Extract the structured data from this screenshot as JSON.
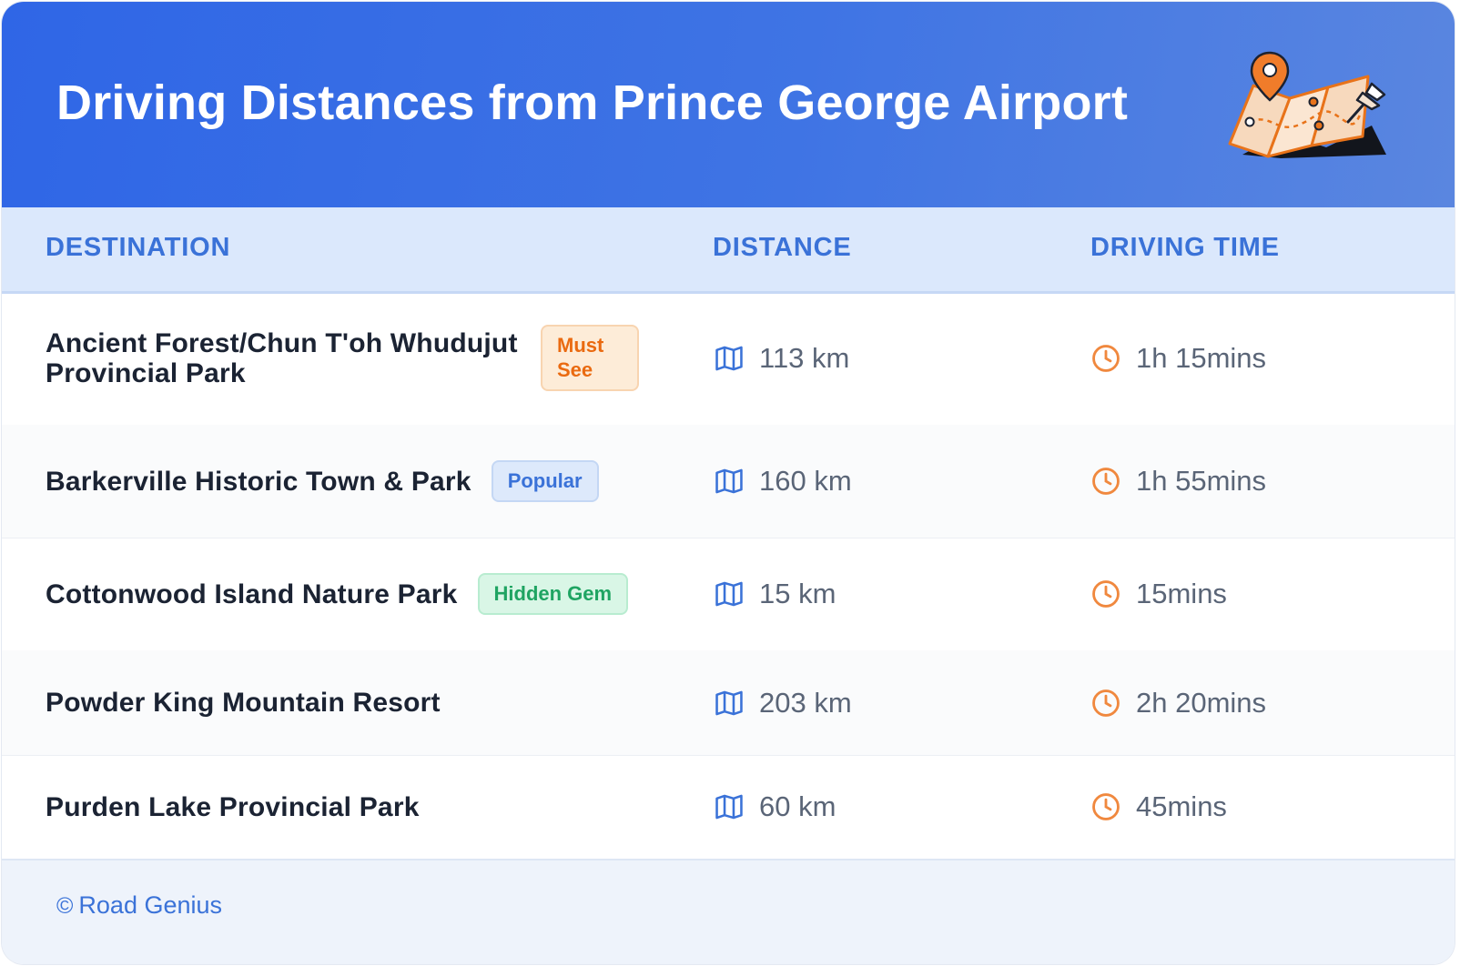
{
  "header": {
    "title": "Driving Distances from Prince George Airport",
    "illustration_icon": "folded-map-with-pins-icon"
  },
  "table": {
    "columns": [
      "DESTINATION",
      "DISTANCE",
      "DRIVING TIME"
    ],
    "rows": [
      {
        "destination": "Ancient Forest/Chun T'oh Whudujut Provincial Park",
        "badge": "Must See",
        "badge_style": "orange",
        "distance": "113 km",
        "time": "1h 15mins"
      },
      {
        "destination": "Barkerville Historic Town & Park",
        "badge": "Popular",
        "badge_style": "blue",
        "distance": "160 km",
        "time": "1h 55mins"
      },
      {
        "destination": "Cottonwood Island Nature Park",
        "badge": "Hidden Gem",
        "badge_style": "green",
        "distance": "15 km",
        "time": "15mins"
      },
      {
        "destination": "Powder King Mountain Resort",
        "badge": "",
        "badge_style": "",
        "distance": "203 km",
        "time": "2h 20mins"
      },
      {
        "destination": "Purden Lake Provincial Park",
        "badge": "",
        "badge_style": "",
        "distance": "60 km",
        "time": "45mins"
      }
    ]
  },
  "icons": {
    "distance": "map-icon",
    "time": "clock-icon"
  },
  "footer": {
    "copyright_symbol": "©",
    "brand": "Road Genius"
  },
  "colors": {
    "header_gradient_start": "#2f66e6",
    "header_gradient_end": "#5a86e0",
    "column_header_bg": "#dbe8fc",
    "accent_blue": "#3a72d8",
    "badge_orange": "#ea6a10",
    "badge_green": "#1fa462",
    "clock_orange": "#f0883e"
  }
}
